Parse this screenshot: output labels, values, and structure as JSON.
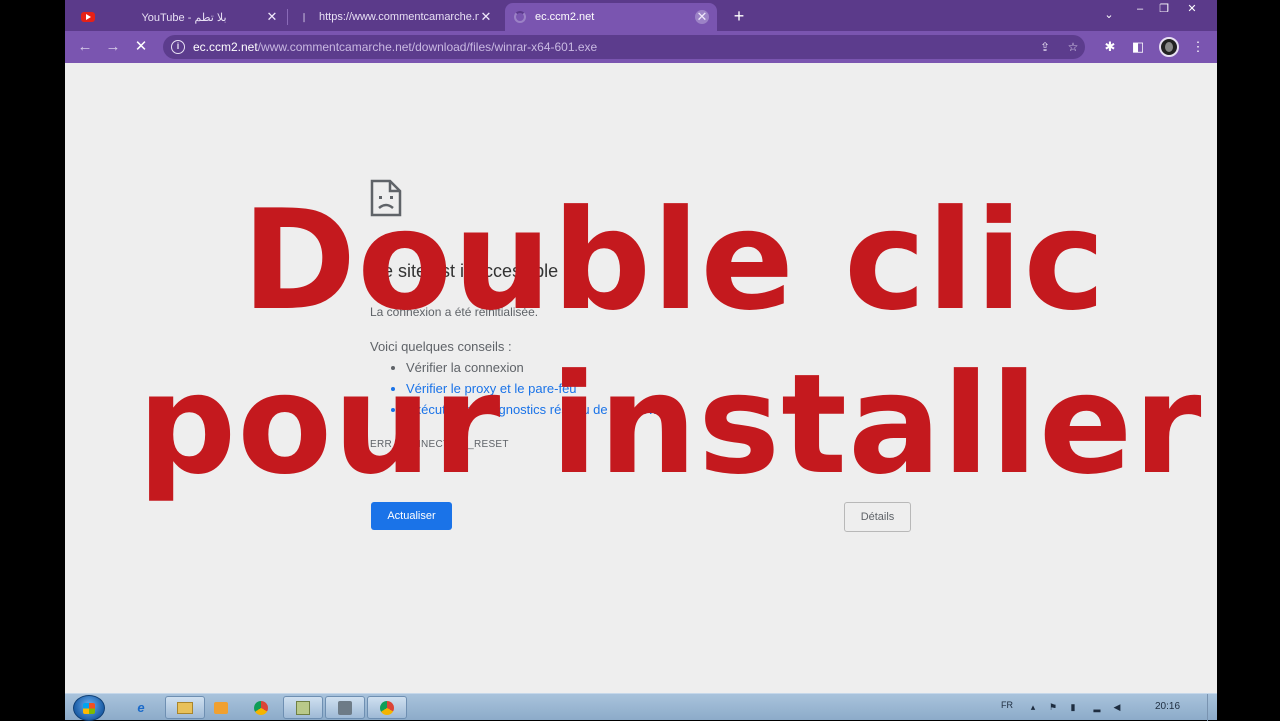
{
  "browser": {
    "tabs": [
      {
        "label": "YouTube - بلا تطم",
        "icon": "youtube-icon"
      },
      {
        "label": "https://www.commentcamarche.net",
        "icon": "page-icon"
      },
      {
        "label": "ec.ccm2.net",
        "icon": "loading-spinner-icon"
      }
    ],
    "new_tab": "+",
    "tab_search": "⌄",
    "window_controls": {
      "minimize": "–",
      "restore": "❐",
      "close": "✕"
    },
    "tab_close": "✕",
    "omnibox": {
      "url_host": "ec.ccm2.net",
      "url_path": "/www.commentcamarche.net/download/files/winrar-x64-601.exe"
    }
  },
  "page": {
    "error_title": "Ce site est inaccessible",
    "error_subtitle": "La connexion a été réinitialisée.",
    "tips_intro": "Voici quelques conseils :",
    "tips": [
      "Vérifier la connexion",
      "Vérifier le proxy et le pare-feu",
      "Exécuter les diagnostics réseau de Windows"
    ],
    "error_code": "ERR_CONNECTION_RESET",
    "reload_button": "Actualiser",
    "details_button": "Détails"
  },
  "overlay": {
    "line1": "Double clic",
    "line2": "pour installer"
  },
  "taskbar": {
    "language": "FR",
    "time": "20:16"
  },
  "colors": {
    "tab_strip": "#5b3a8a",
    "toolbar": "#7a55b0",
    "overlay_text": "#c4191e",
    "reload_button": "#1a73e8",
    "link": "#1a73e8"
  }
}
